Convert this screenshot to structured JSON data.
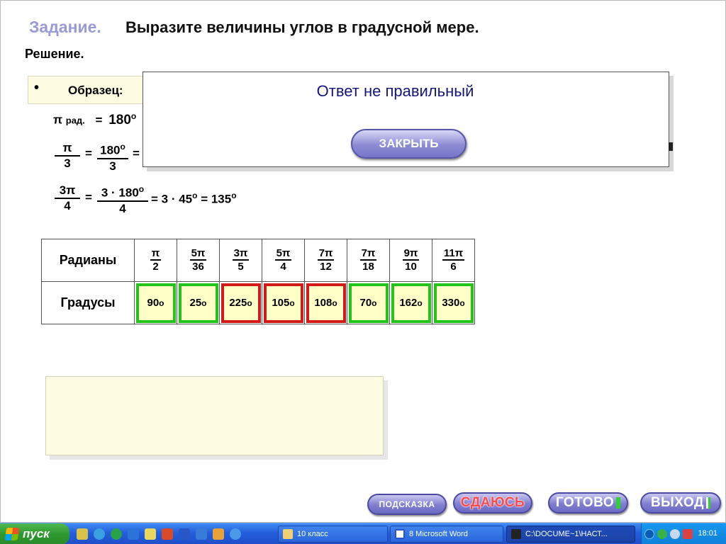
{
  "task": {
    "label": "Задание.",
    "text": "Выразите величины углов в градусной мере."
  },
  "solution_label": "Решение.",
  "sample": {
    "bullet": "•",
    "label": "Образец:"
  },
  "examples": {
    "line1": {
      "pi": "π",
      "rad": "рад.",
      "eq": "=",
      "value": "180",
      "deg": "o"
    },
    "line2": {
      "num": "π",
      "den": "3",
      "eq1": "=",
      "num2": "180",
      "deg": "o",
      "den2": "3",
      "eq2": "="
    },
    "line3": {
      "num": "3π",
      "den": "4",
      "eq1": "=",
      "num2": "3 · 180",
      "deg": "o",
      "den2": "4",
      "tail": "= 3 · 45",
      "tail_deg": "o",
      "result": "= 135",
      "result_deg": "o"
    }
  },
  "table": {
    "row1_header": "Радианы",
    "row2_header": "Градусы",
    "radians": [
      {
        "num": "π",
        "den": "2"
      },
      {
        "num": "5π",
        "den": "36"
      },
      {
        "num": "3π",
        "den": "5"
      },
      {
        "num": "5π",
        "den": "4"
      },
      {
        "num": "7π",
        "den": "12"
      },
      {
        "num": "7π",
        "den": "18"
      },
      {
        "num": "9π",
        "den": "10"
      },
      {
        "num": "11π",
        "den": "6"
      }
    ],
    "answers": [
      {
        "value": "90",
        "deg": "o",
        "status": "correct"
      },
      {
        "value": "25",
        "deg": "o",
        "status": "correct"
      },
      {
        "value": "225",
        "deg": "o",
        "status": "wrong"
      },
      {
        "value": "105",
        "deg": "o",
        "status": "wrong"
      },
      {
        "value": "108",
        "deg": "o",
        "status": "wrong"
      },
      {
        "value": "70",
        "deg": "o",
        "status": "correct"
      },
      {
        "value": "162",
        "deg": "o",
        "status": "correct"
      },
      {
        "value": "330",
        "deg": "o",
        "status": "correct"
      }
    ]
  },
  "buttons": {
    "hint": "ПОДСКАЗКА",
    "giveup": "СДАЮСЬ",
    "done": "ГОТОВО",
    "exit": "ВЫХОД"
  },
  "modal": {
    "title": "Ответ не правильный",
    "close": "ЗАКРЫТЬ"
  },
  "taskbar": {
    "start": "пуск",
    "tasks": [
      {
        "label": "10 класс",
        "icon": "folder-icon"
      },
      {
        "label": "8 Microsoft Word",
        "icon": "word-icon"
      },
      {
        "label": "C:\\DOCUME~1\\НАСТ...",
        "icon": "console-icon"
      }
    ],
    "clock": "18:01"
  },
  "colors": {
    "correct": "#22c41a",
    "wrong": "#d21a1a",
    "answer_bg": "#ffffc8",
    "accent": "#7f7ed0"
  }
}
